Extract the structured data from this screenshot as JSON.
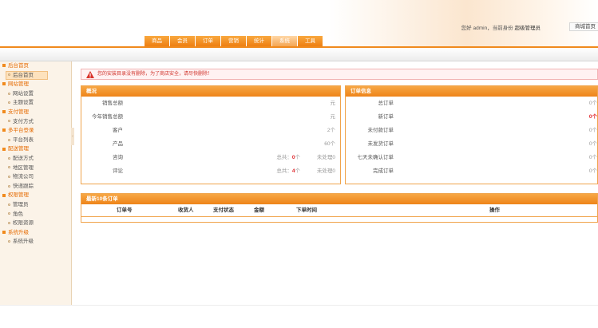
{
  "header": {
    "greeting": "您好 admin，当前身份",
    "role": "超级管理员",
    "home_link": "商城首页"
  },
  "nav": {
    "tabs": [
      "商品",
      "会员",
      "订单",
      "营销",
      "统计",
      "系统",
      "工具"
    ],
    "active_index": 5
  },
  "sidebar": {
    "groups": [
      {
        "label": "后台首页",
        "items": [
          "后台首页"
        ]
      },
      {
        "label": "网站管理",
        "items": [
          "网站设置",
          "主题设置"
        ]
      },
      {
        "label": "支付管理",
        "items": [
          "支付方式"
        ]
      },
      {
        "label": "多平台登录",
        "items": [
          "平台列表"
        ]
      },
      {
        "label": "配送管理",
        "items": [
          "配送方式",
          "地区管理",
          "物流公司",
          "快递跟踪"
        ]
      },
      {
        "label": "权限管理",
        "items": [
          "管理员",
          "角色",
          "权限资源"
        ]
      },
      {
        "label": "系统升级",
        "items": [
          "系统升级"
        ]
      }
    ],
    "active_item": "后台首页"
  },
  "notice": {
    "text": "您的安装目录没有删除，为了商店安全，请尽快删除！"
  },
  "overview": {
    "title": "概况",
    "rows": [
      {
        "label": "销售总额",
        "value": "元"
      },
      {
        "label": "今年销售总额",
        "value": "元"
      },
      {
        "label": "客户",
        "value": "2个"
      },
      {
        "label": "产品",
        "value": "60个"
      },
      {
        "label": "咨询",
        "total_prefix": "总共：",
        "total": "0",
        "total_suffix": "个",
        "pending": "未处理0"
      },
      {
        "label": "评论",
        "total_prefix": "总共：",
        "total": "4",
        "total_suffix": "个",
        "pending": "未处理0"
      }
    ]
  },
  "orders": {
    "title": "订单信息",
    "rows": [
      {
        "label": "总订单",
        "value": "0个"
      },
      {
        "label": "新订单",
        "value": "0个"
      },
      {
        "label": "未付款订单",
        "value": "0个"
      },
      {
        "label": "未发货订单",
        "value": "0个"
      },
      {
        "label": "七天未确认订单",
        "value": "0个"
      },
      {
        "label": "完成订单",
        "value": "0个"
      }
    ]
  },
  "latest_orders": {
    "title": "最新10条订单",
    "columns": [
      "订单号",
      "收货人",
      "支付状态",
      "金额",
      "下单时间",
      "操作"
    ]
  },
  "colors": {
    "accent": "#f08a1d",
    "danger": "#e0262b"
  },
  "icons": {
    "notice": "warning-triangle-icon",
    "sidebar_group": "square-bullet-icon",
    "sidebar_item": "circle-bullet-icon",
    "collapse": "chevron-left-icon"
  }
}
